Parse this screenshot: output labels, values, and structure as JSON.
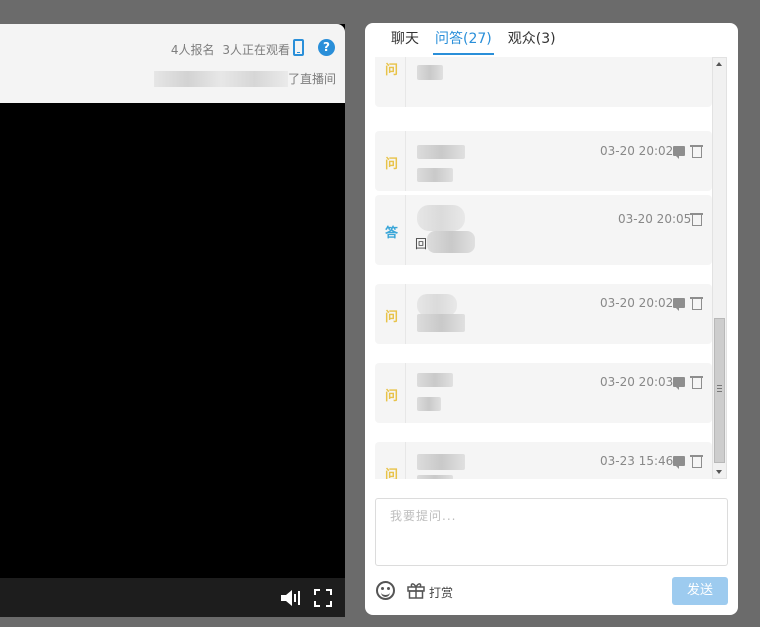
{
  "player": {
    "registered": "4人报名",
    "watching": "3人正在观看",
    "subline_suffix": "了直播间",
    "help_glyph": "?"
  },
  "tabs": [
    {
      "label": "聊天",
      "active": false
    },
    {
      "label": "问答(27)",
      "active": true
    },
    {
      "label": "观众(3)",
      "active": false
    }
  ],
  "qa": {
    "badge_question": "问",
    "badge_answer": "答",
    "items": [
      {
        "kind": "question",
        "time": ""
      },
      {
        "kind": "question",
        "time": "03-20 20:02"
      },
      {
        "kind": "answer",
        "time": "03-20 20:05",
        "text": "回"
      },
      {
        "kind": "question",
        "time": "03-20 20:02"
      },
      {
        "kind": "question",
        "time": "03-20 20:03"
      },
      {
        "kind": "question",
        "time": "03-23 15:46"
      }
    ]
  },
  "composer": {
    "placeholder": "我要提问...",
    "reward_label": "打赏",
    "send_label": "发送"
  },
  "colors": {
    "accent": "#2a8fd9",
    "question_badge": "#e8c34a",
    "answer_badge": "#3aa6d8",
    "send_disabled": "#9dcbef"
  },
  "icons": [
    "phone-icon",
    "help-icon",
    "volume-icon",
    "fullscreen-icon",
    "reply-icon",
    "trash-icon",
    "emoji-icon",
    "gift-icon"
  ]
}
